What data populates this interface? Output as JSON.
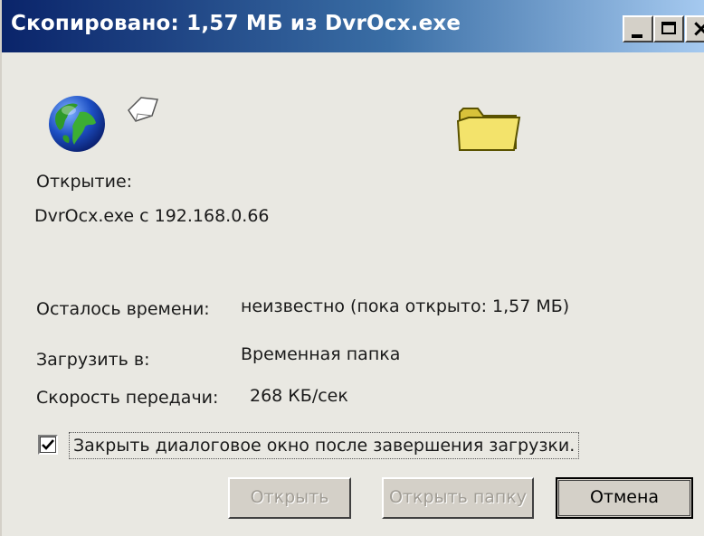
{
  "window": {
    "title": "Скопировано: 1,57 МБ из DvrOcx.exe",
    "close_glyph": "×",
    "titlebar_colors": [
      "#0a246a",
      "#a6caf0"
    ]
  },
  "icons": {
    "globe": "globe-icon",
    "paper": "document-icon",
    "folder": "folder-icon"
  },
  "status": {
    "action_label": "Открытие:",
    "source": "DvrOcx.exe с 192.168.0.66"
  },
  "details": {
    "time_left_label": "Осталось времени:",
    "time_left_value": "неизвестно (пока открыто: 1,57 МБ)",
    "download_to_label": "Загрузить в:",
    "download_to_value": "Временная папка",
    "speed_label": "Скорость передачи:",
    "speed_value": "268 КБ/сек"
  },
  "options": {
    "close_on_complete_label": "Закрыть диалоговое окно после завершения загрузки.",
    "close_on_complete_checked": true
  },
  "buttons": {
    "open": "Открыть",
    "open_folder": "Открыть папку",
    "cancel": "Отмена"
  }
}
